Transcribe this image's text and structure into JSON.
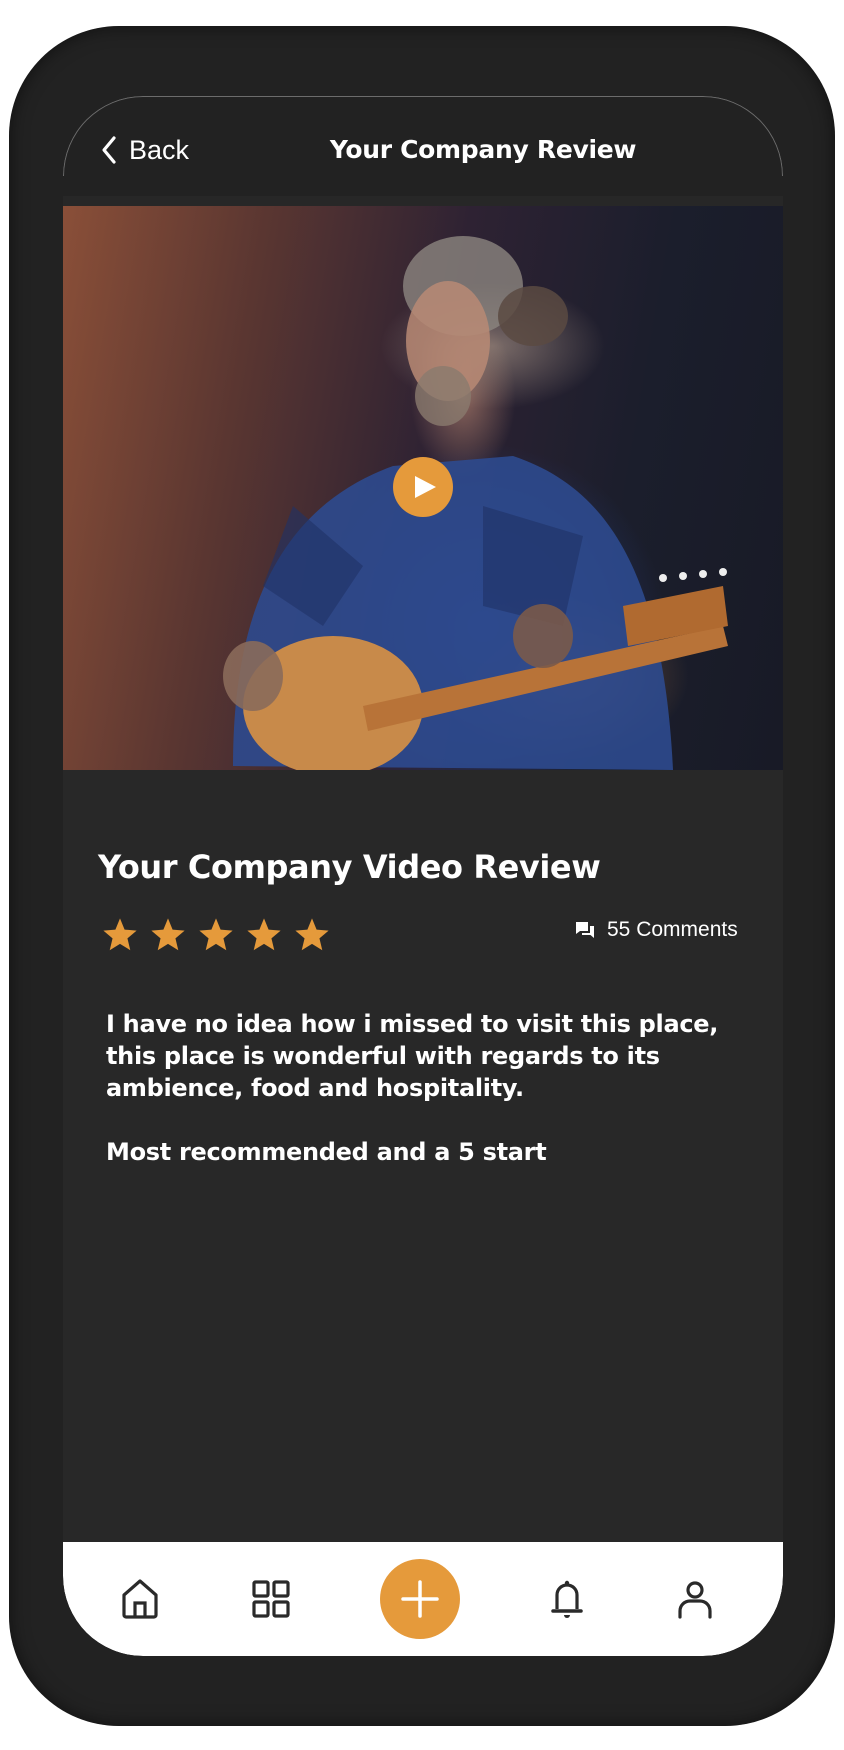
{
  "header": {
    "back_label": "Back",
    "title": "Your Company Review"
  },
  "video": {
    "thumbnail_alt": "Man with grey beard in blue plaid shirt playing electric guitar",
    "play_icon": "play-icon"
  },
  "review": {
    "title": "Your Company Video Review",
    "rating": 5,
    "rating_max": 5,
    "comments_count": "55",
    "comments_label": "55 Comments",
    "body_paragraphs": [
      "I have no idea how i missed to visit this place, this place is wonderful with regards to its ambience, food and hospitality.",
      "Most recommended and a 5 start"
    ]
  },
  "navbar": {
    "items": [
      {
        "name": "home",
        "icon": "home-icon"
      },
      {
        "name": "grid",
        "icon": "grid-icon"
      },
      {
        "name": "add",
        "icon": "plus-icon"
      },
      {
        "name": "notifications",
        "icon": "bell-icon"
      },
      {
        "name": "profile",
        "icon": "user-icon"
      }
    ]
  },
  "colors": {
    "accent": "#E59A3B",
    "background": "#282828",
    "header": "#222222",
    "frame": "#222222",
    "navbar": "#FFFFFF",
    "text": "#FFFFFF",
    "icon": "#2A2A2A"
  }
}
